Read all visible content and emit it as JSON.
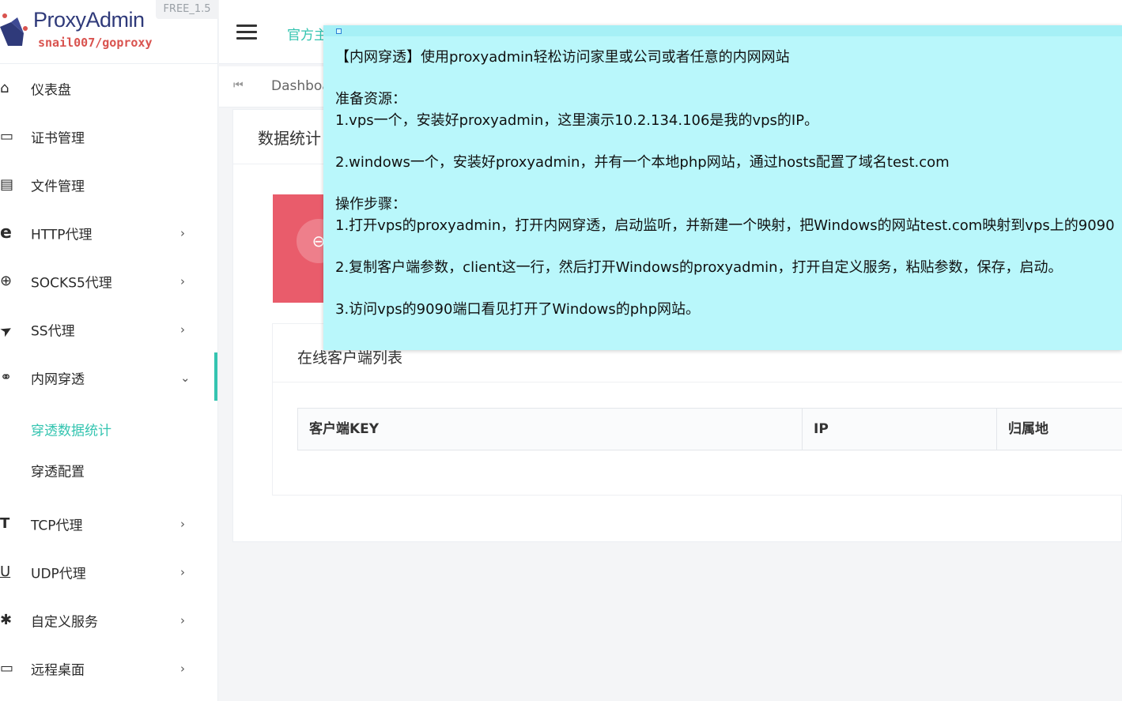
{
  "app": {
    "title": "ProxyAdmin",
    "subtitle": "snail007/goproxy",
    "version": "FREE_1.5"
  },
  "sidebar": {
    "items": [
      {
        "label": "仪表盘",
        "icon": "home-icon",
        "glyph": "⌂",
        "arrow": ""
      },
      {
        "label": "证书管理",
        "icon": "card-icon",
        "glyph": "▭",
        "arrow": ""
      },
      {
        "label": "文件管理",
        "icon": "file-icon",
        "glyph": "▤",
        "arrow": ""
      },
      {
        "label": "HTTP代理",
        "icon": "ie-icon",
        "glyph": "e",
        "arrow": "›"
      },
      {
        "label": "SOCKS5代理",
        "icon": "globe-icon",
        "glyph": "⊕",
        "arrow": "›"
      },
      {
        "label": "SS代理",
        "icon": "send-icon",
        "glyph": "➤",
        "arrow": "›"
      },
      {
        "label": "内网穿透",
        "icon": "link-icon",
        "glyph": "⚭",
        "arrow": "⌄"
      },
      {
        "label": "TCP代理",
        "icon": "t-icon",
        "glyph": "T",
        "arrow": "›"
      },
      {
        "label": "UDP代理",
        "icon": "u-icon",
        "glyph": "U",
        "arrow": "›"
      },
      {
        "label": "自定义服务",
        "icon": "puzzle-icon",
        "glyph": "✱",
        "arrow": "›"
      },
      {
        "label": "远程桌面",
        "icon": "monitor-icon",
        "glyph": "▭",
        "arrow": "›"
      }
    ],
    "subitems": [
      {
        "label": "穿透数据统计",
        "active": true
      },
      {
        "label": "穿透配置",
        "active": false
      }
    ]
  },
  "topbar": {
    "link": "官方主"
  },
  "breadcrumb": {
    "first_icon": "⏮",
    "text": "Dashboa"
  },
  "main": {
    "card_title": "数据统计",
    "stat_icon": "⊖",
    "online_title": "在线客户端列表",
    "table_headers": [
      "客户端KEY",
      "IP",
      "归属地"
    ]
  },
  "note": {
    "lines": [
      "【内网穿透】使用proxyadmin轻松访问家里或公司或者任意的内网网站",
      "准备资源：",
      "1.vps一个，安装好proxyadmin，这里演示10.2.134.106是我的vps的IP。",
      "2.windows一个，安装好proxyadmin，并有一个本地php网站，通过hosts配置了域名test.com",
      "操作步骤：",
      "1.打开vps的proxyadmin，打开内网穿透，启动监听，并新建一个映射，把Windows的网站test.com映射到vps上的9090",
      "2.复制客户端参数，client这一行，然后打开Windows的proxyadmin，打开自定义服务，粘贴参数，保存，启动。",
      "3.访问vps的9090端口看见打开了Windows的php网站。"
    ]
  },
  "colors": {
    "accent": "#34c4b0",
    "note_bg": "#b9f7fb",
    "stat_red": "#e95c6b",
    "brand_blue": "#2f3a7a",
    "brand_red": "#d9534f"
  }
}
